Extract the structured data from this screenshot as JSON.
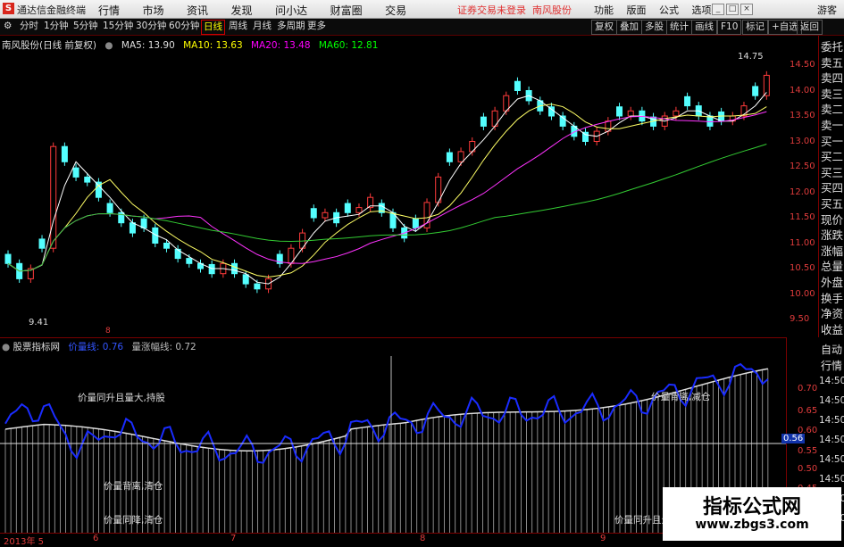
{
  "window": {
    "app_name": "通达信金融终端",
    "menu": [
      "行情",
      "市场",
      "资讯",
      "发现",
      "问小达",
      "财富圈",
      "交易"
    ],
    "alert": "证券交易未登录",
    "stock_tab": "南风股份",
    "right_menu": [
      "功能",
      "版面",
      "公式",
      "选项"
    ],
    "guest": "游客",
    "logo": "S"
  },
  "toolbar": {
    "periods": [
      "分时",
      "1分钟",
      "5分钟",
      "15分钟",
      "30分钟",
      "60分钟",
      "日线",
      "周线",
      "月线",
      "多周期",
      "更多"
    ],
    "active_period": "日线",
    "right_buttons": [
      "复权",
      "叠加",
      "多股",
      "统计",
      "画线",
      "F10",
      "标记",
      "+自选",
      "返回"
    ]
  },
  "main_chart": {
    "title": "南风股份(日线 前复权)",
    "ma": [
      {
        "label": "MA5: 13.90",
        "color": "#ffffff"
      },
      {
        "label": "MA10: 13.63",
        "color": "#ffff00"
      },
      {
        "label": "MA20: 13.48",
        "color": "#ff00ff"
      },
      {
        "label": "MA60: 12.81",
        "color": "#00ff00"
      }
    ],
    "high_marker": "14.75",
    "low_marker": "9.41",
    "price_ticks": [
      "14.50",
      "14.00",
      "13.50",
      "13.00",
      "12.50",
      "12.00",
      "11.50",
      "11.00",
      "10.50",
      "10.00",
      "9.50"
    ]
  },
  "sub_chart": {
    "title": "股票指标网",
    "line1": "价量线: 0.76",
    "line2": "量涨幅线: 0.72",
    "ticks": [
      "0.70",
      "0.65",
      "0.60",
      "0.56",
      "0.55",
      "0.50",
      "0.45"
    ],
    "current_value": "0.56",
    "annotations": {
      "a1": "价量同升且量大,持股",
      "a2": "价量背离,清仓",
      "a3": "价量同降,清仓",
      "a4": "价量背离,减仓",
      "a5": "价量同升且量"
    }
  },
  "right_panel": {
    "items": [
      "委托",
      "卖五",
      "卖四",
      "卖三",
      "卖二",
      "卖一",
      "买一",
      "买二",
      "买三",
      "买四",
      "买五",
      "现价",
      "涨跌",
      "涨幅",
      "总量",
      "外盘",
      "换手",
      "净资",
      "收益"
    ],
    "lower": [
      "自动",
      "行情"
    ],
    "times": [
      "14:50",
      "14:50",
      "14:50",
      "14:50",
      "14:50",
      "14:50",
      "14:50",
      "14:50"
    ]
  },
  "date_axis": {
    "labels": [
      "2013年 5",
      "6",
      "7",
      "8",
      "9"
    ],
    "marker": "8"
  },
  "watermark": {
    "line1": "指标公式网",
    "line2": "www.zbgs3.com"
  }
}
